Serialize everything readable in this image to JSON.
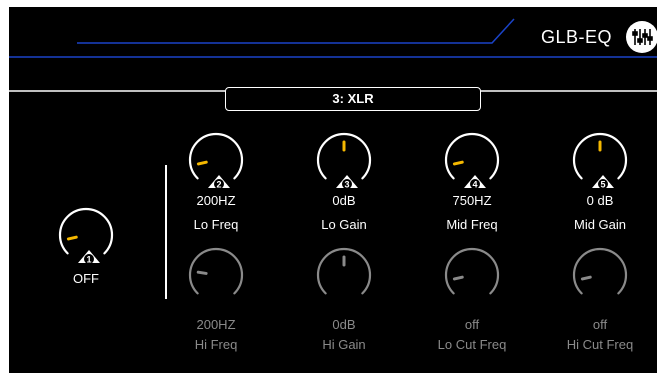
{
  "header": {
    "title": "GLB-EQ",
    "icon": "equalizer-icon"
  },
  "tab": {
    "label": "3: XLR"
  },
  "main_knob": {
    "number": "1",
    "value": "OFF",
    "level": 0.12
  },
  "top_row": [
    {
      "number": "2",
      "value": "200HZ",
      "label": "Lo Freq",
      "level": 0.12
    },
    {
      "number": "3",
      "value": "0dB",
      "label": "Lo Gain",
      "level": 0.5
    },
    {
      "number": "4",
      "value": "750HZ",
      "label": "Mid Freq",
      "level": 0.12
    },
    {
      "number": "5",
      "value": "0 dB",
      "label": "Mid Gain",
      "level": 0.5
    }
  ],
  "bottom_row": [
    {
      "value": "200HZ",
      "label": "Hi Freq",
      "level": 0.2
    },
    {
      "value": "0dB",
      "label": "Hi Gain",
      "level": 0.5
    },
    {
      "value": "off",
      "label": "Lo Cut Freq",
      "level": 0.12
    },
    {
      "value": "off",
      "label": "Hi Cut Freq",
      "level": 0.12
    }
  ],
  "colors": {
    "accent_blue": "#1a43c8",
    "indicator": "#f5b800",
    "inactive": "#8a8a8a",
    "background": "#000000"
  }
}
